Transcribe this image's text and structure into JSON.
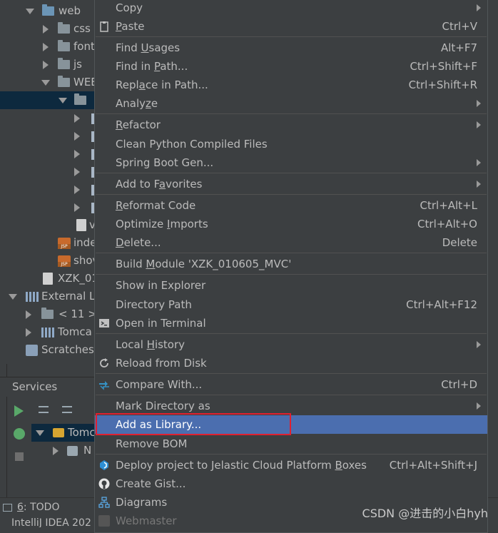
{
  "tree": {
    "web": "web",
    "css": "css",
    "font": "font",
    "js": "js",
    "webinf": "WEB",
    "w_file": "v",
    "index_jsp": "inde",
    "show_jsp": "shov",
    "xzk_file": "XZK_01",
    "external": "External Li",
    "jdk": "< 11 >",
    "tomcat": "Tomca",
    "scratches": "Scratches"
  },
  "services": {
    "title": "Services",
    "tomcat_item": "Tomc",
    "n_item": "N"
  },
  "bottom": {
    "todo_num": "6",
    "todo_label": ": TODO",
    "status": "IntelliJ IDEA 202"
  },
  "menu": {
    "copy": "Copy",
    "paste_u": "P",
    "paste_rest": "aste",
    "paste_sc": "Ctrl+V",
    "find_usages_a": "Find ",
    "find_usages_u": "U",
    "find_usages_b": "sages",
    "find_usages_sc": "Alt+F7",
    "find_in_path_a": "Find in ",
    "find_in_path_u": "P",
    "find_in_path_b": "ath...",
    "find_in_path_sc": "Ctrl+Shift+F",
    "replace_a": "Repl",
    "replace_u": "a",
    "replace_b": "ce in Path...",
    "replace_sc": "Ctrl+Shift+R",
    "analyze_a": "Analy",
    "analyze_u": "z",
    "analyze_b": "e",
    "refactor_u": "R",
    "refactor_b": "efactor",
    "clean_python": "Clean Python Compiled Files",
    "spring_boot": "Spring Boot Gen...",
    "add_fav_a": "Add to F",
    "add_fav_u": "a",
    "add_fav_b": "vorites",
    "reformat_u": "R",
    "reformat_b": "eformat Code",
    "reformat_sc": "Ctrl+Alt+L",
    "optimize_a": "Optimize ",
    "optimize_u": "I",
    "optimize_b": "mports",
    "optimize_sc": "Ctrl+Alt+O",
    "delete_u": "D",
    "delete_b": "elete...",
    "delete_sc": "Delete",
    "build_a": "Build ",
    "build_u": "M",
    "build_b": "odule 'XZK_010605_MVC'",
    "show_explorer": "Show in Explorer",
    "dir_path": "Directory Path",
    "dir_path_sc": "Ctrl+Alt+F12",
    "open_terminal": "Open in Terminal",
    "local_hist_a": "Local ",
    "local_hist_u": "H",
    "local_hist_b": "istory",
    "reload": "Reload from Disk",
    "compare": "Compare With...",
    "compare_sc": "Ctrl+D",
    "mark_dir": "Mark Directory as",
    "add_library": "Add as Library...",
    "remove_bom": "Remove BOM",
    "deploy_a": "Deploy project to Jelastic Cloud Platform ",
    "deploy_u": "B",
    "deploy_b": "oxes",
    "deploy_sc": "Ctrl+Alt+Shift+J",
    "create_gist": "Create Gist...",
    "diagrams": "Diagrams",
    "webmaster": "Webmaster"
  },
  "watermark": "CSDN @进击的小白hyh",
  "colors": {
    "highlight": "#4b6eaf",
    "annotation": "#e0202f",
    "background": "#3c3f41"
  }
}
